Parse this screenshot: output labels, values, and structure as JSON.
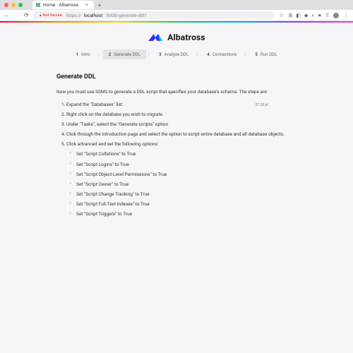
{
  "browser": {
    "tab_title": "Home · Albatross",
    "not_secure_label": "Not Secure",
    "url_protocol": "https://",
    "url_host": "localhost",
    "url_path": ":9000/generate-ddl?"
  },
  "brand": {
    "name": "Albatross"
  },
  "steps": [
    {
      "num": "1",
      "label": "Intro"
    },
    {
      "num": "2",
      "label": "Generate DDL"
    },
    {
      "num": "3",
      "label": "Analyze DDL"
    },
    {
      "num": "4",
      "label": "Connections"
    },
    {
      "num": "5",
      "label": "Run DDL"
    }
  ],
  "page": {
    "title": "Generate DDL",
    "intro": "Now you must use SSMS to generate a DDL script that specifies your database's schema. The steps are:",
    "tiny_pt": "57.53 pt",
    "ol": [
      "Expand the \"Databases\" list.",
      "Right click on the database you wish to migrate.",
      "Under \"Tasks\", select the \"Generate scripts\" option",
      "Click through the Introduction page and select the option to script entire database and all database objects.",
      "Click advanced and set the following options:"
    ],
    "sub": [
      "Set \"Script Collations\" to True",
      "Set \"Script Logins\" to True",
      "Set \"Script Object-Level Permissions\" to True",
      "Set \"Script Owner\" to True",
      "Set \"Script Change Tracking\" to True",
      "Set \"Script Full-Text Indexes\" to True",
      "Set \"Script Triggers\" to True"
    ]
  }
}
